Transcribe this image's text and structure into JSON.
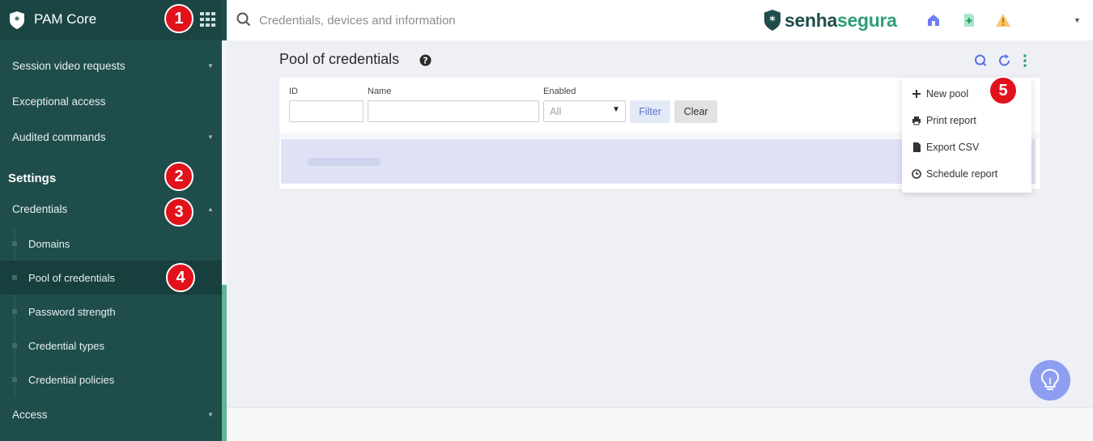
{
  "sidebar": {
    "app_title": "PAM Core",
    "items": [
      {
        "label": "Session video requests"
      },
      {
        "label": "Exceptional access"
      },
      {
        "label": "Audited commands"
      }
    ],
    "section_title": "Settings",
    "credentials_label": "Credentials",
    "sub_items": [
      {
        "label": "Domains"
      },
      {
        "label": "Pool of credentials"
      },
      {
        "label": "Password strength"
      },
      {
        "label": "Credential types"
      },
      {
        "label": "Credential policies"
      }
    ],
    "access_label": "Access"
  },
  "topbar": {
    "search_placeholder": "Credentials, devices and information",
    "brand_part1": "senha",
    "brand_part2": "segura"
  },
  "main": {
    "page_title": "Pool of credentials",
    "filter": {
      "id_label": "ID",
      "name_label": "Name",
      "enabled_label": "Enabled",
      "enabled_value": "All",
      "filter_button": "Filter",
      "clear_button": "Clear"
    },
    "menu": {
      "new_pool": "New pool",
      "print_report": "Print report",
      "export_csv": "Export CSV",
      "schedule_report": "Schedule report"
    }
  },
  "badges": [
    "1",
    "2",
    "3",
    "4",
    "5"
  ],
  "colors": {
    "sidebar_bg": "#1f4d4b",
    "accent_green": "#2f9e74",
    "badge_red": "#e1121b",
    "action_blue": "#5a72e0"
  },
  "icons": {
    "logo": "shield-asterisk-icon",
    "apps": "grid-icon",
    "search": "search-icon",
    "home": "home-icon",
    "add_doc": "add-document-icon",
    "warning": "warning-icon",
    "help": "help-icon",
    "search_action": "search-icon",
    "refresh": "refresh-icon",
    "more": "more-vertical-icon",
    "idea": "lightbulb-icon"
  }
}
